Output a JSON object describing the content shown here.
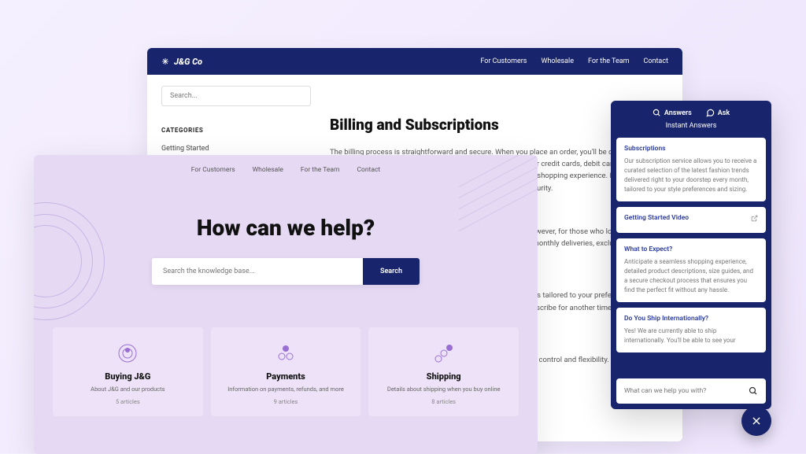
{
  "back": {
    "brand": "J&G Co",
    "nav": [
      "For Customers",
      "Wholesale",
      "For the Team",
      "Contact"
    ],
    "search_placeholder": "Search...",
    "categories_label": "CATEGORIES",
    "categories": [
      "Getting Started"
    ],
    "article": {
      "title": "Billing and Subscriptions",
      "p1": "The billing process is straightforward and secure. When you place an order, you'll be charged via the payment method you've selected at checkout. We accept major credit cards, debit cards, and other secure payment options to ensure a seamless and hassle-free shopping experience. Rest assured, your financial details are handled with the utmost care and security.",
      "p2": "Shopping at our store is easy and requires no subscription. However, for those who love staying on top of the latest trends, we offer a subscription featuring curated monthly deliveries, exclusive discounts, early access, and more. Subscribing is entirely optional.",
      "p3": "Once subscribed to the service you'll receive monthly selections tailored to your preferences. If you ever need to skip a month based on your preferences or unsubscribe for another time, simply visit My Account > Subscription Preferences.",
      "p4": "You'd like to receive and start controlling what you receive with control and flexibility."
    }
  },
  "front": {
    "nav": [
      "For Customers",
      "Wholesale",
      "For the Team",
      "Contact"
    ],
    "hero_title": "How can we help?",
    "search_placeholder": "Search the knowledge base...",
    "search_button": "Search",
    "cards": [
      {
        "title": "Buying J&G",
        "sub": "About J&G and our products",
        "count": "5 articles"
      },
      {
        "title": "Payments",
        "sub": "Information on payments, refunds, and more",
        "count": "9 articles"
      },
      {
        "title": "Shipping",
        "sub": "Details about shipping when you buy online",
        "count": "8 articles"
      }
    ]
  },
  "widget": {
    "tab_answers": "Answers",
    "tab_ask": "Ask",
    "subtitle": "Instant Answers",
    "answers": [
      {
        "title": "Subscriptions",
        "body": "Our subscription service allows you to receive a curated selection of the latest fashion trends delivered right to your doorstep every month, tailored to your style preferences and sizing."
      },
      {
        "title": "Getting Started Video",
        "body": ""
      },
      {
        "title": "What to Expect?",
        "body": "Anticipate a seamless shopping experience, detailed product descriptions, size guides, and a secure checkout process that ensures you find the perfect fit without any hassle."
      },
      {
        "title": "Do You Ship Internationally?",
        "body": "Yes! We are currently able to ship internationally. You'll be able to see your"
      }
    ],
    "input_placeholder": "What can we help you with?"
  },
  "colors": {
    "navy": "#18246b",
    "lavender": "#e5d9f3",
    "card": "#ede2f7",
    "link": "#2a3a9c"
  }
}
